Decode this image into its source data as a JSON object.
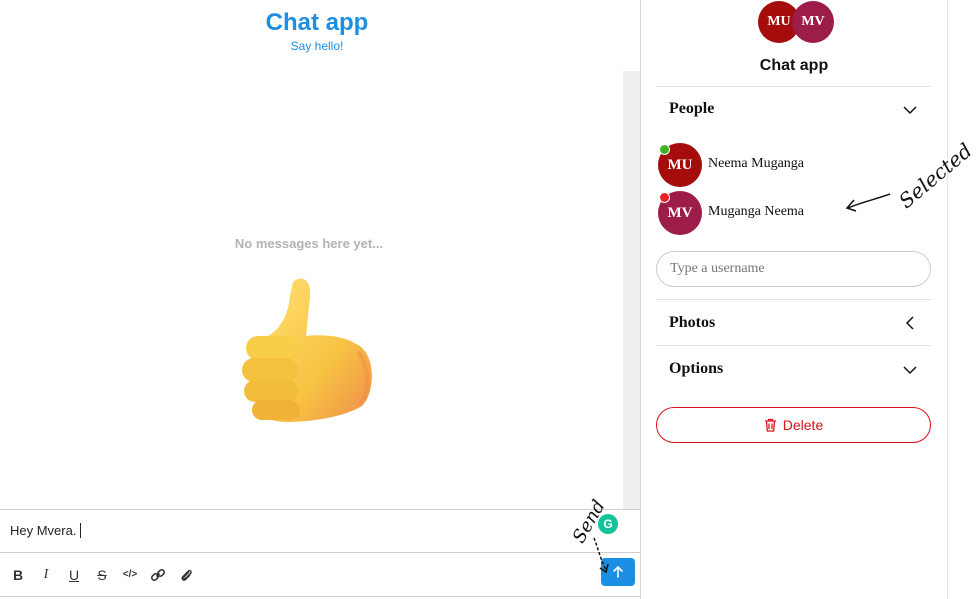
{
  "chat": {
    "title": "Chat app",
    "subtitle": "Say hello!",
    "empty_text": "No messages here yet..."
  },
  "composer": {
    "value": "Hey Mvera.",
    "grammarly_icon": "G",
    "toolbar": [
      {
        "name": "bold-button",
        "icon": "B"
      },
      {
        "name": "italic-button",
        "icon": "I"
      },
      {
        "name": "underline-button",
        "icon": "U"
      },
      {
        "name": "strikethrough-button",
        "icon": "S"
      },
      {
        "name": "code-button",
        "icon": "</>"
      },
      {
        "name": "link-button",
        "icon": "link"
      },
      {
        "name": "attachment-button",
        "icon": "paperclip"
      }
    ],
    "send_icon": "arrow-up"
  },
  "sidebar": {
    "avatars": [
      "MU",
      "MV"
    ],
    "title": "Chat app",
    "people_label": "People",
    "people": [
      {
        "initials": "MU",
        "name": "Neema Muganga",
        "status": "online",
        "status_color": "#3cb521",
        "avatar_color": "#a50d0d"
      },
      {
        "initials": "MV",
        "name": "Muganga Neema",
        "status": "offline",
        "status_color": "#e82222",
        "avatar_color": "#9c1c4a"
      }
    ],
    "username_placeholder": "Type a username",
    "photos_label": "Photos",
    "options_label": "Options",
    "delete_label": "Delete"
  },
  "annotations": {
    "selected": "Selected",
    "send": "Send"
  },
  "colors": {
    "accent": "#1a8fe3",
    "danger": "#d9121a",
    "online": "#3cb521",
    "offline": "#e82222"
  }
}
